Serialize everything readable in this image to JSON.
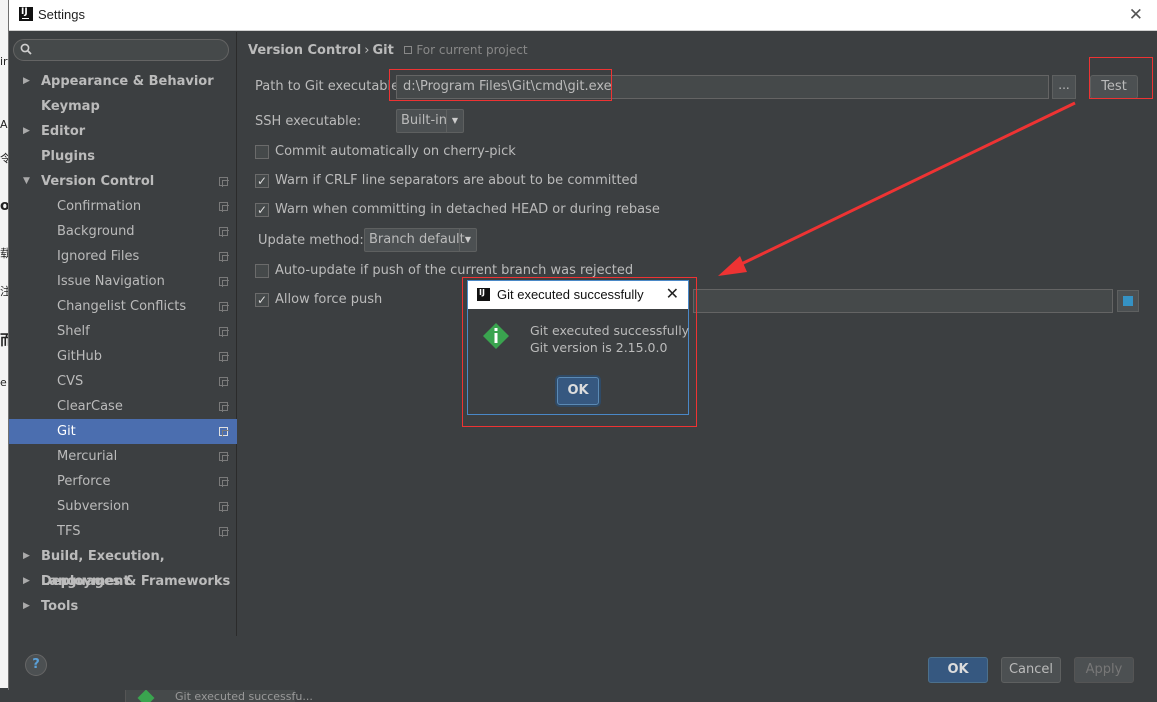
{
  "background": {
    "left_fragments": [
      "ir",
      "A",
      "令",
      "o",
      "载",
      "注",
      "而",
      "e"
    ],
    "bottom_text": "Git executed successfu..."
  },
  "window": {
    "title": "Settings",
    "logo_text": "IJ",
    "close_glyph": "✕"
  },
  "sidebar": {
    "search_placeholder": "",
    "items": [
      {
        "label": "Appearance & Behavior",
        "level": 0,
        "expanded": false
      },
      {
        "label": "Keymap",
        "level": 0
      },
      {
        "label": "Editor",
        "level": 0,
        "expanded": false
      },
      {
        "label": "Plugins",
        "level": 0
      },
      {
        "label": "Version Control",
        "level": 0,
        "expanded": true
      },
      {
        "label": "Confirmation",
        "level": 1
      },
      {
        "label": "Background",
        "level": 1
      },
      {
        "label": "Ignored Files",
        "level": 1
      },
      {
        "label": "Issue Navigation",
        "level": 1
      },
      {
        "label": "Changelist Conflicts",
        "level": 1
      },
      {
        "label": "Shelf",
        "level": 1
      },
      {
        "label": "GitHub",
        "level": 1
      },
      {
        "label": "CVS",
        "level": 1
      },
      {
        "label": "ClearCase",
        "level": 1
      },
      {
        "label": "Git",
        "level": 1,
        "selected": true
      },
      {
        "label": "Mercurial",
        "level": 1
      },
      {
        "label": "Perforce",
        "level": 1
      },
      {
        "label": "Subversion",
        "level": 1
      },
      {
        "label": "TFS",
        "level": 1
      },
      {
        "label": "Build, Execution, Deployment",
        "level": 0,
        "expanded": false
      },
      {
        "label": "Languages & Frameworks",
        "level": 0,
        "expanded": false
      },
      {
        "label": "Tools",
        "level": 0,
        "expanded": false
      }
    ]
  },
  "breadcrumb": {
    "parent": "Version Control",
    "separator": "›",
    "current": "Git",
    "scope": "For current project"
  },
  "git_settings": {
    "path_label": "Path to Git executable:",
    "path_value": "d:\\Program Files\\Git\\cmd\\git.exe",
    "browse_label": "...",
    "test_label": "Test",
    "ssh_label": "SSH executable:",
    "ssh_value": "Built-in",
    "cherry_pick_label": "Commit automatically on cherry-pick",
    "cherry_pick_checked": false,
    "crlf_label": "Warn if CRLF line separators are about to be committed",
    "crlf_checked": true,
    "detached_label": "Warn when committing in detached HEAD or during rebase",
    "detached_checked": true,
    "update_method_label": "Update method:",
    "update_method_value": "Branch default",
    "auto_update_label": "Auto-update if push of the current branch was rejected",
    "auto_update_checked": false,
    "force_push_label": "Allow force push",
    "force_push_checked": true
  },
  "footer": {
    "help_label": "?",
    "ok_label": "OK",
    "cancel_label": "Cancel",
    "apply_label": "Apply"
  },
  "popup": {
    "title": "Git executed successfully",
    "close_glyph": "✕",
    "message_line1": "Git executed successfully",
    "message_line2": "Git version is 2.15.0.0",
    "ok_label": "OK"
  },
  "colors": {
    "accent_selected": "#4b6eaf",
    "annotation_red": "#ee3333",
    "dialog_background": "#3c3f41"
  }
}
